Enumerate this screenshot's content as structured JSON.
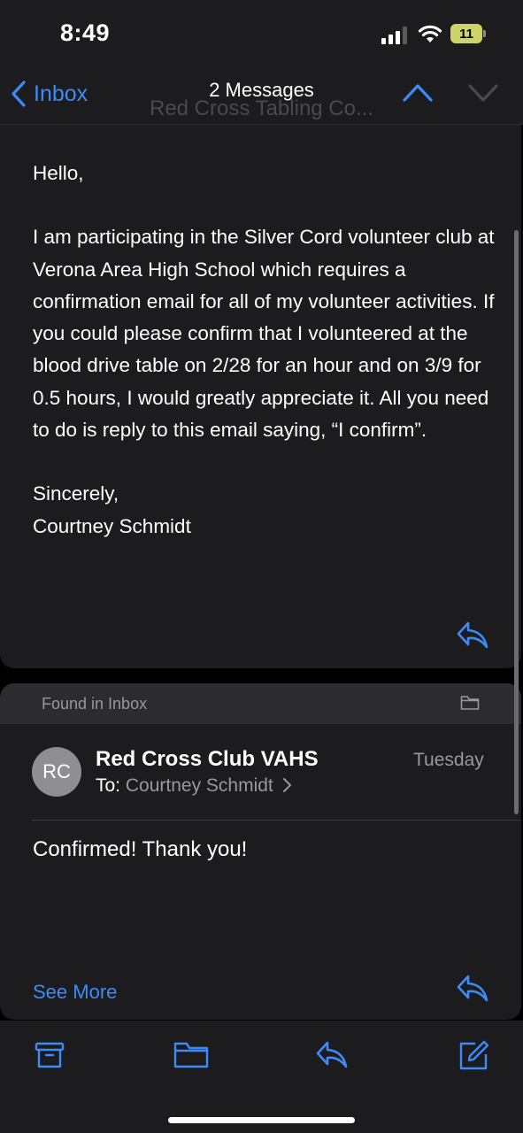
{
  "status": {
    "time": "8:49",
    "battery": "11"
  },
  "nav": {
    "back_label": "Inbox",
    "title": "2 Messages",
    "subtitle": "Red Cross Tabling Co..."
  },
  "message1": {
    "greeting": "Hello,",
    "body": "I am participating in the Silver Cord volunteer club at Verona Area High School which requires a confirmation email for all of my volunteer activities. If you could please confirm that I volunteered at the blood drive table on 2/28 for an hour and on 3/9 for 0.5 hours, I would greatly appreciate it. All you need to do is reply to this email saying, “I confirm”.",
    "signoff": "Sincerely,",
    "signature": "Courtney Schmidt"
  },
  "message2": {
    "found_label": "Found in Inbox",
    "avatar_initials": "RC",
    "sender": "Red Cross Club VAHS",
    "date": "Tuesday",
    "to_label": "To:",
    "recipient": "Courtney Schmidt",
    "body": "Confirmed! Thank you!",
    "see_more": "See More"
  },
  "colors": {
    "accent": "#3d8bf7",
    "background": "#000000",
    "card": "#1c1c1e",
    "secondary_text": "#98989e"
  },
  "icons": [
    "back-chevron-icon",
    "chevron-up-icon",
    "chevron-down-icon",
    "reply-icon",
    "folder-icon",
    "archive-icon",
    "compose-icon"
  ]
}
